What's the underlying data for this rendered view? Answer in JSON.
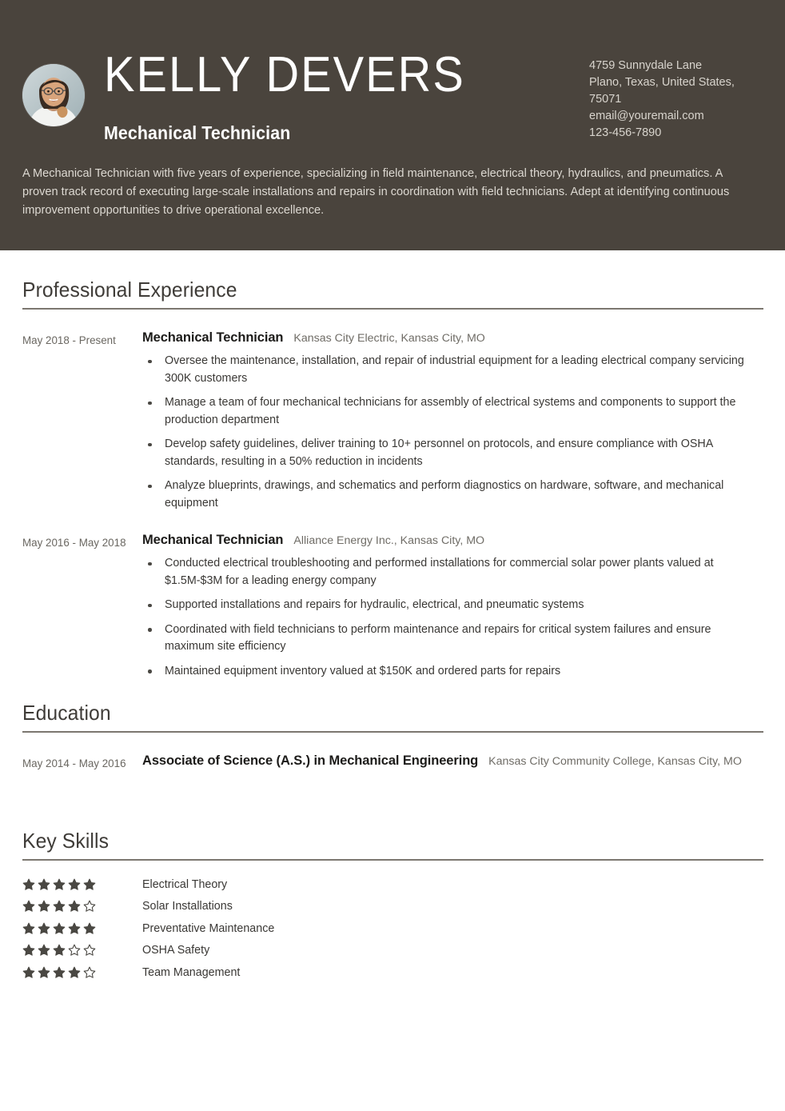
{
  "header": {
    "name": "KELLY DEVERS",
    "job_title": "Mechanical Technician",
    "avatar_icon": "profile-photo",
    "bg_color": "#4a443d",
    "contact": [
      "4759 Sunnydale Lane",
      "Plano, Texas, United States,",
      "75071",
      "email@youremail.com",
      "123-456-7890"
    ],
    "summary": "A Mechanical Technician with five years of experience, specializing in field maintenance, electrical theory, hydraulics, and pneumatics. A proven track record of executing large-scale installations and repairs in coordination with field technicians. Adept at identifying continuous improvement opportunities to drive operational excellence."
  },
  "sections": {
    "experience": {
      "title": "Professional Experience",
      "entries": [
        {
          "date": "May 2018 - Present",
          "role": "Mechanical Technician",
          "org": "Kansas City Electric, Kansas City, MO",
          "bullets": [
            "Oversee the maintenance, installation, and repair of industrial equipment for a leading electrical company servicing 300K customers",
            "Manage a team of four mechanical technicians for assembly of electrical systems and components to support the production department",
            "Develop safety guidelines, deliver training to 10+ personnel on protocols, and ensure compliance with OSHA standards, resulting in a 50% reduction in incidents",
            "Analyze blueprints, drawings, and schematics and perform diagnostics on hardware, software, and mechanical equipment"
          ]
        },
        {
          "date": "May 2016 - May 2018",
          "role": "Mechanical Technician",
          "org": "Alliance Energy Inc., Kansas City, MO",
          "bullets": [
            "Conducted electrical troubleshooting and performed installations for commercial solar power plants valued at $1.5M-$3M for a leading energy company",
            "Supported installations and repairs for hydraulic, electrical, and pneumatic systems",
            "Coordinated with field technicians to perform maintenance and repairs for critical system failures and ensure maximum site efficiency",
            "Maintained equipment inventory valued at $150K and ordered parts for repairs"
          ]
        }
      ]
    },
    "education": {
      "title": "Education",
      "entries": [
        {
          "date": "May 2014 - May 2016",
          "degree": "Associate of Science (A.S.) in Mechanical Engineering",
          "school": "Kansas City Community College, Kansas City, MO"
        }
      ]
    },
    "skills": {
      "title": "Key Skills",
      "max_rating": 5,
      "items": [
        {
          "label": "Electrical Theory",
          "rating": 5
        },
        {
          "label": "Solar Installations",
          "rating": 4
        },
        {
          "label": "Preventative Maintenance",
          "rating": 5
        },
        {
          "label": "OSHA Safety",
          "rating": 3
        },
        {
          "label": "Team Management",
          "rating": 4
        }
      ]
    }
  },
  "colors": {
    "header_bg": "#4a443d",
    "rule": "#7c7770",
    "star_filled": "#4a4843",
    "muted_text": "#6f6c66"
  }
}
